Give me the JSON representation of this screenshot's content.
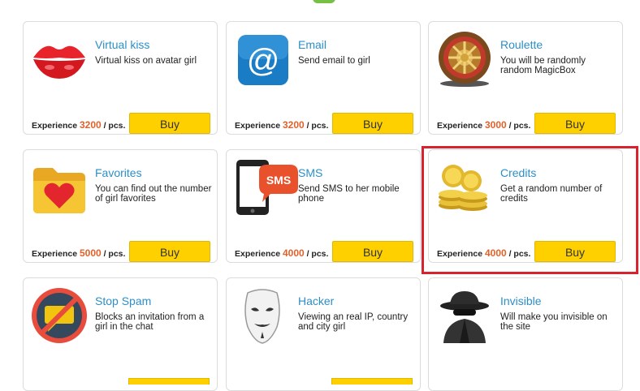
{
  "items": [
    {
      "title": "Virtual kiss",
      "desc": "Virtual kiss on avatar girl",
      "exp_label": "Experience",
      "exp_value": "3200",
      "exp_unit": "/ pcs.",
      "buy": "Buy",
      "icon": "lips-icon"
    },
    {
      "title": "Email",
      "desc": "Send email to girl",
      "exp_label": "Experience",
      "exp_value": "3200",
      "exp_unit": "/ pcs.",
      "buy": "Buy",
      "icon": "email-icon"
    },
    {
      "title": "Roulette",
      "desc": "You will be randomly random MagicBox",
      "exp_label": "Experience",
      "exp_value": "3000",
      "exp_unit": "/ pcs.",
      "buy": "Buy",
      "icon": "roulette-icon"
    },
    {
      "title": "Favorites",
      "desc": "You can find out the number of girl favorites",
      "exp_label": "Experience",
      "exp_value": "5000",
      "exp_unit": "/ pcs.",
      "buy": "Buy",
      "icon": "favorites-folder-icon"
    },
    {
      "title": "SMS",
      "desc": "Send SMS to her mobile phone",
      "exp_label": "Experience",
      "exp_value": "4000",
      "exp_unit": "/ pcs.",
      "buy": "Buy",
      "icon": "sms-phone-icon"
    },
    {
      "title": "Credits",
      "desc": "Get a random number of credits",
      "exp_label": "Experience",
      "exp_value": "4000",
      "exp_unit": "/ pcs.",
      "buy": "Buy",
      "icon": "coins-icon"
    },
    {
      "title": "Stop Spam",
      "desc": "Blocks an invitation from a girl in the chat",
      "icon": "stop-spam-icon"
    },
    {
      "title": "Hacker",
      "desc": "Viewing an real IP, country and city girl",
      "icon": "hacker-mask-icon"
    },
    {
      "title": "Invisible",
      "desc": "Will make you invisible on the site",
      "icon": "spy-icon"
    }
  ],
  "colors": {
    "title": "#2c8fc7",
    "exp_number": "#e0612b",
    "buy_button": "#ffd000",
    "highlight": "#d6232e"
  }
}
